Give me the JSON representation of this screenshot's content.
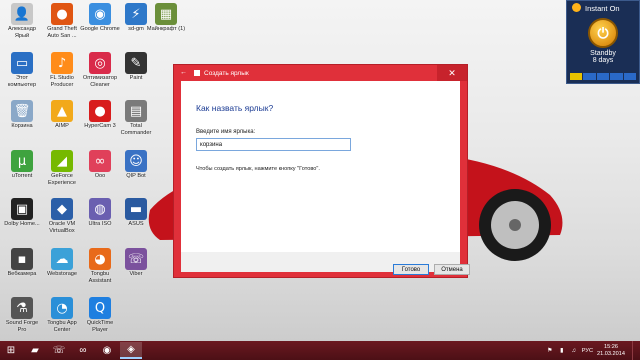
{
  "desktop": {
    "icons": [
      {
        "label": "Александр Ярый",
        "name": "user-folder-icon",
        "glyph": "👤",
        "color": "#c8c8c8"
      },
      {
        "label": "Grand Theft Auto San ...",
        "name": "gta-san-andreas-icon",
        "glyph": "●",
        "color": "#e05512"
      },
      {
        "label": "Google Chrome",
        "name": "google-chrome-icon",
        "glyph": "◉",
        "color": "#3b8fe0"
      },
      {
        "label": "sd-gm",
        "name": "sd-gm-icon",
        "glyph": "⚡",
        "color": "#2e78c9"
      },
      {
        "label": "Майнкрафт (1)",
        "name": "minecraft-icon",
        "glyph": "▦",
        "color": "#6b8f3a"
      },
      {
        "label": "Этот компьютер",
        "name": "this-pc-icon",
        "glyph": "▭",
        "color": "#2a6fc4"
      },
      {
        "label": "FL Studio Producer",
        "name": "fl-studio-icon",
        "glyph": "♪",
        "color": "#ff8c1a"
      },
      {
        "label": "Оптимизатор Cleaner",
        "name": "cleaner-icon",
        "glyph": "◎",
        "color": "#d92b4a"
      },
      {
        "label": "Paint",
        "name": "paint-icon",
        "glyph": "✎",
        "color": "#333333"
      },
      {
        "label": "Корзина",
        "name": "recycle-bin-icon",
        "glyph": "🗑",
        "color": "#8aa8c8"
      },
      {
        "label": "AIMP",
        "name": "aimp-icon",
        "glyph": "▲",
        "color": "#f2a91a"
      },
      {
        "label": "HyperCam 3",
        "name": "hypercam-icon",
        "glyph": "●",
        "color": "#d81c1c"
      },
      {
        "label": "Total Commander",
        "name": "total-commander-icon",
        "glyph": "▤",
        "color": "#7a7a7a"
      },
      {
        "label": "uTorrent",
        "name": "utorrent-icon",
        "glyph": "µ",
        "color": "#3fa33f"
      },
      {
        "label": "GeForce Experience",
        "name": "geforce-icon",
        "glyph": "◢",
        "color": "#76b900"
      },
      {
        "label": "Ooo",
        "name": "ooo-icon",
        "glyph": "∞",
        "color": "#e0405a"
      },
      {
        "label": "QIP Bot",
        "name": "ghost-icon",
        "glyph": "☺",
        "color": "#3a72c4"
      },
      {
        "label": "Dolby Home...",
        "name": "dolby-icon",
        "glyph": "▣",
        "color": "#222222"
      },
      {
        "label": "Oracle VM VirtualBox",
        "name": "virtualbox-icon",
        "glyph": "◆",
        "color": "#2b5fa8"
      },
      {
        "label": "Ultra ISO",
        "name": "ultraiso-icon",
        "glyph": "◍",
        "color": "#6a5fb0"
      },
      {
        "label": "ASUS",
        "name": "asus-icon",
        "glyph": "▬",
        "color": "#2a5aa0"
      },
      {
        "label": "Вебкамера",
        "name": "webcam-icon",
        "glyph": "▪",
        "color": "#444444"
      },
      {
        "label": "Webstorage",
        "name": "webstorage-icon",
        "glyph": "☁",
        "color": "#3ba1d8"
      },
      {
        "label": "Tongbu Assistant",
        "name": "tongbu-assistant-icon",
        "glyph": "◕",
        "color": "#e86a1a"
      },
      {
        "label": "Viber",
        "name": "viber-icon",
        "glyph": "☏",
        "color": "#7b519d"
      },
      {
        "label": "Sound Forge Pro",
        "name": "sound-forge-icon",
        "glyph": "⚗",
        "color": "#555555"
      },
      {
        "label": "Tongbu App Center",
        "name": "tongbu-app-center-icon",
        "glyph": "◔",
        "color": "#2a8fd8"
      },
      {
        "label": "QuickTime Player",
        "name": "quicktime-icon",
        "glyph": "Q",
        "color": "#1f7fe0"
      }
    ]
  },
  "gadget": {
    "title": "Instant On",
    "state": "Standby",
    "days": "8 days"
  },
  "dialog": {
    "title": "Создать ярлык",
    "heading": "Как назвать ярлык?",
    "prompt": "Введите имя ярлыка:",
    "input_value": "корзина",
    "hint": "Чтобы создать ярлык, нажмите кнопку \"Готово\".",
    "ok_label": "Готово",
    "cancel_label": "Отмена",
    "close_glyph": "✕",
    "back_glyph": "←"
  },
  "taskbar": {
    "start_glyph": "⊞",
    "buttons": [
      {
        "name": "file-explorer-icon",
        "glyph": "▰"
      },
      {
        "name": "viber-taskbar-icon",
        "glyph": "☏"
      },
      {
        "name": "visual-studio-icon",
        "glyph": "∞"
      },
      {
        "name": "chrome-taskbar-icon",
        "glyph": "◉"
      },
      {
        "name": "active-window-icon",
        "glyph": "◈"
      }
    ],
    "lang": "РУС",
    "time": "15:26",
    "date": "21.03.2014"
  },
  "colors": {
    "dialog_accent": "#e0303a",
    "taskbar": "#5c131a"
  }
}
